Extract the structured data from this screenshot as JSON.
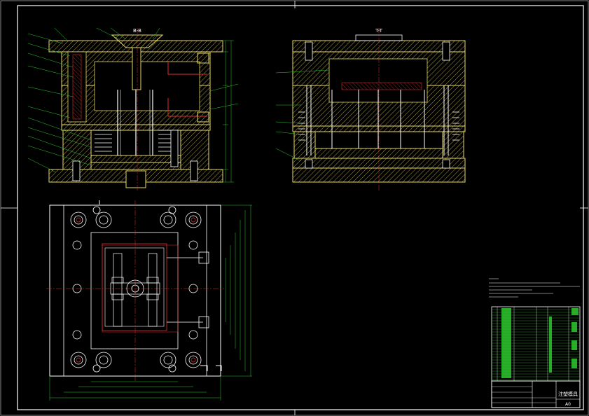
{
  "drawing": {
    "view_labels": {
      "section_a": "B-B",
      "section_b": "T-T"
    },
    "title_block": {
      "drawing_name": "注塑模具",
      "scale": "A0"
    }
  }
}
